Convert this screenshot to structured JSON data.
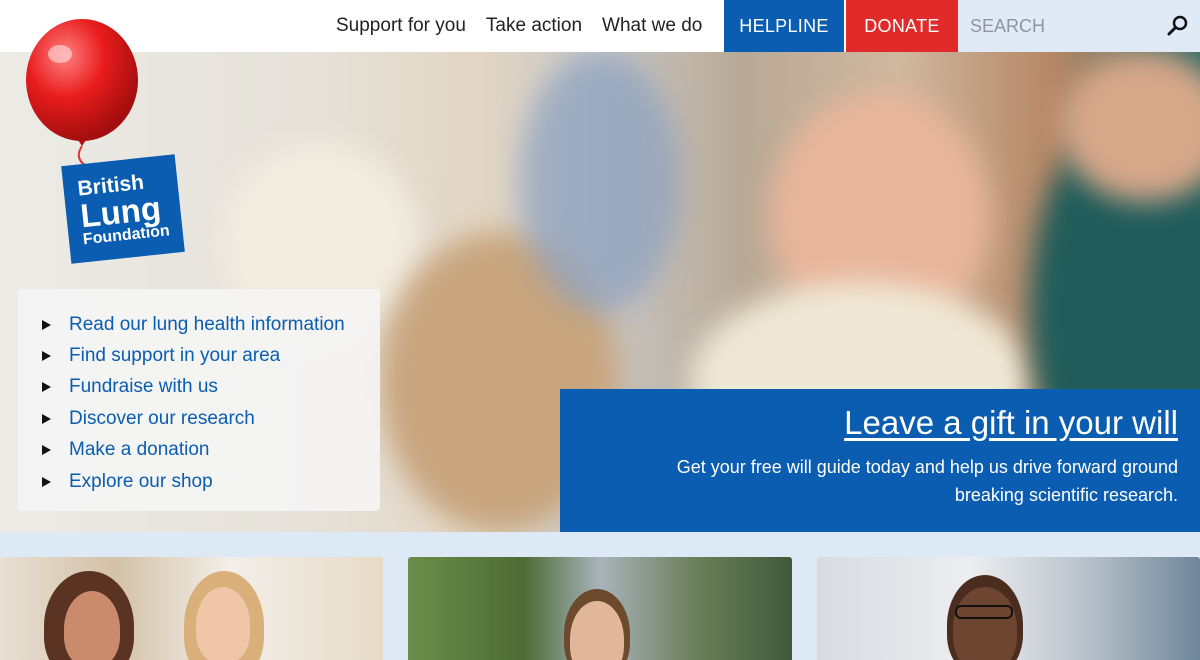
{
  "nav": {
    "links": [
      "Support for you",
      "Take action",
      "What we do"
    ],
    "helpline_label": "HELPLINE",
    "donate_label": "DONATE",
    "search_placeholder": "SEARCH"
  },
  "logo": {
    "line1": "British",
    "line2": "Lung",
    "line3": "Foundation"
  },
  "quick_links": [
    "Read our lung health information",
    "Find support in your area",
    "Fundraise with us",
    "Discover our research",
    "Make a donation",
    "Explore our shop"
  ],
  "promo": {
    "title": "Leave a gift in your will",
    "subtitle": "Get your free will guide today and help us drive forward ground breaking scientific research."
  },
  "colors": {
    "brand_blue": "#0a5db0",
    "donate_red": "#e12a2a",
    "search_bg": "#dfeaf6"
  }
}
